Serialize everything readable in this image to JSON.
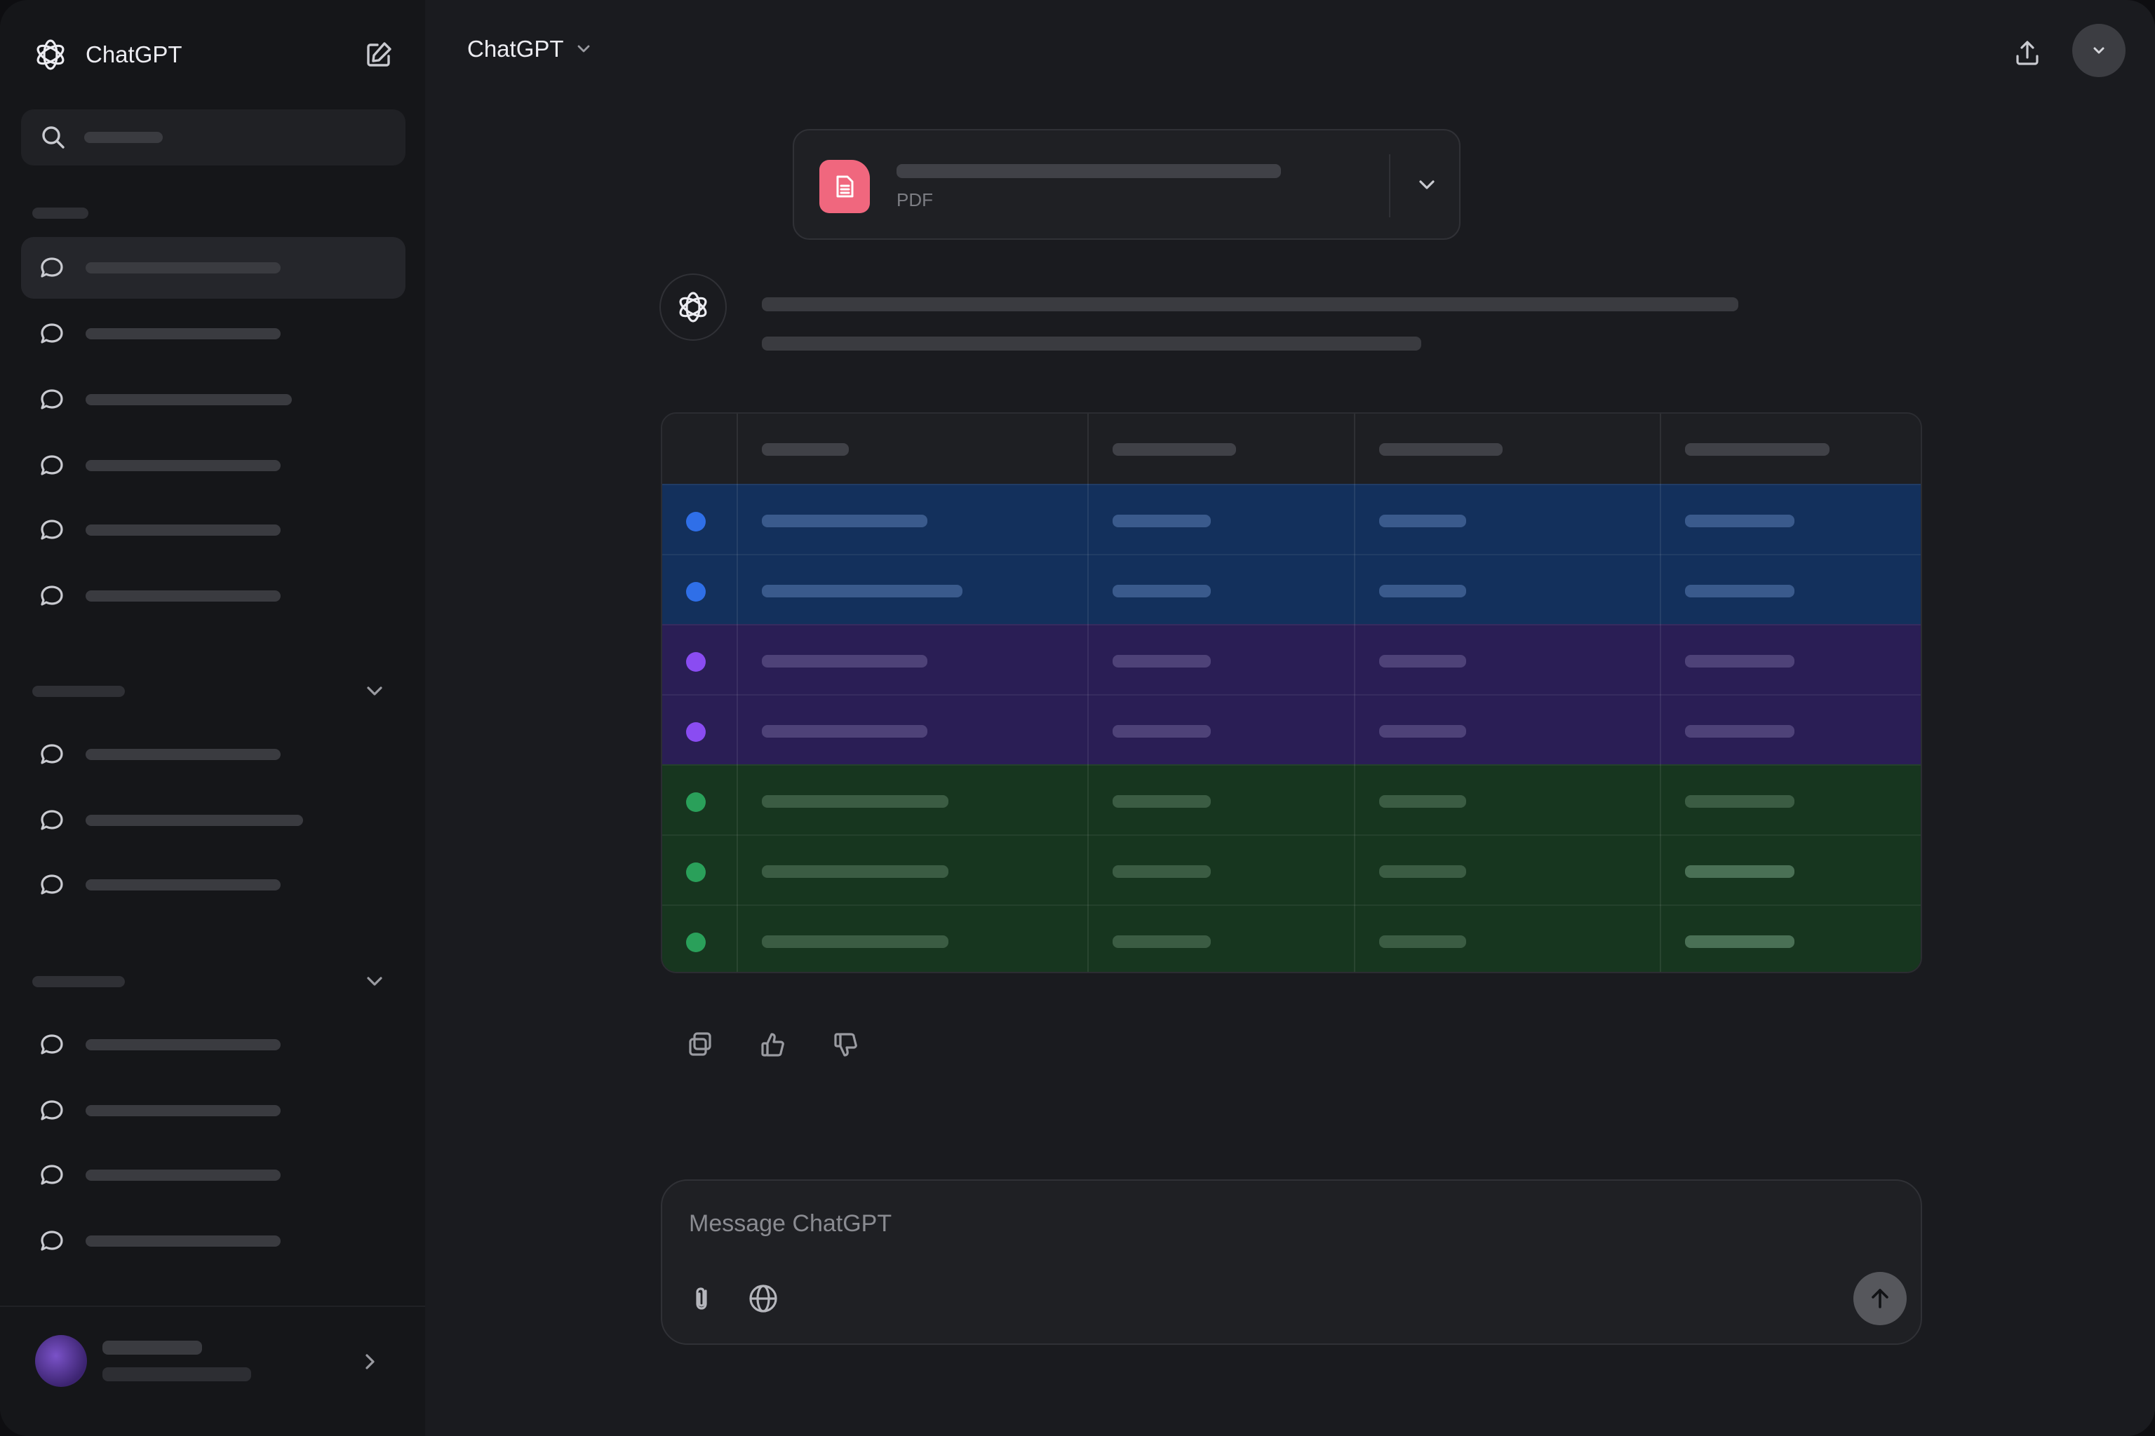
{
  "app": {
    "name": "ChatGPT",
    "model_selector": "ChatGPT"
  },
  "sidebar": {
    "search_placeholder": "",
    "sections": [
      {
        "label": "",
        "items": [
          "",
          "",
          "",
          "",
          "",
          ""
        ],
        "active_index": 0
      },
      {
        "label": "",
        "collapsible": true,
        "items": [
          "",
          "",
          ""
        ]
      },
      {
        "label": "",
        "collapsible": true,
        "items": [
          "",
          "",
          "",
          ""
        ]
      }
    ],
    "profile": {
      "name": "",
      "plan": ""
    }
  },
  "attachment": {
    "filename": "",
    "type": "PDF",
    "icon": "document-icon",
    "color": "#f0677e"
  },
  "table": {
    "headers": [
      "",
      "",
      "",
      ""
    ],
    "rows": [
      {
        "group": "blue",
        "color": "#2f6fe8",
        "cells": [
          "",
          "",
          "",
          ""
        ]
      },
      {
        "group": "blue",
        "color": "#2f6fe8",
        "cells": [
          "",
          "",
          "",
          ""
        ]
      },
      {
        "group": "purple",
        "color": "#8a4cf2",
        "cells": [
          "",
          "",
          "",
          ""
        ]
      },
      {
        "group": "purple",
        "color": "#8a4cf2",
        "cells": [
          "",
          "",
          "",
          ""
        ]
      },
      {
        "group": "green",
        "color": "#2aa05a",
        "cells": [
          "",
          "",
          "",
          ""
        ]
      },
      {
        "group": "green",
        "color": "#2aa05a",
        "cells": [
          "",
          "",
          "",
          ""
        ]
      },
      {
        "group": "green",
        "color": "#2aa05a",
        "cells": [
          "",
          "",
          "",
          ""
        ]
      }
    ]
  },
  "message_actions": [
    "copy-icon",
    "thumbs-up-icon",
    "thumbs-down-icon"
  ],
  "composer": {
    "placeholder": "Message ChatGPT",
    "tools": [
      "paperclip-icon",
      "globe-icon"
    ],
    "send_icon": "arrow-up-icon"
  }
}
